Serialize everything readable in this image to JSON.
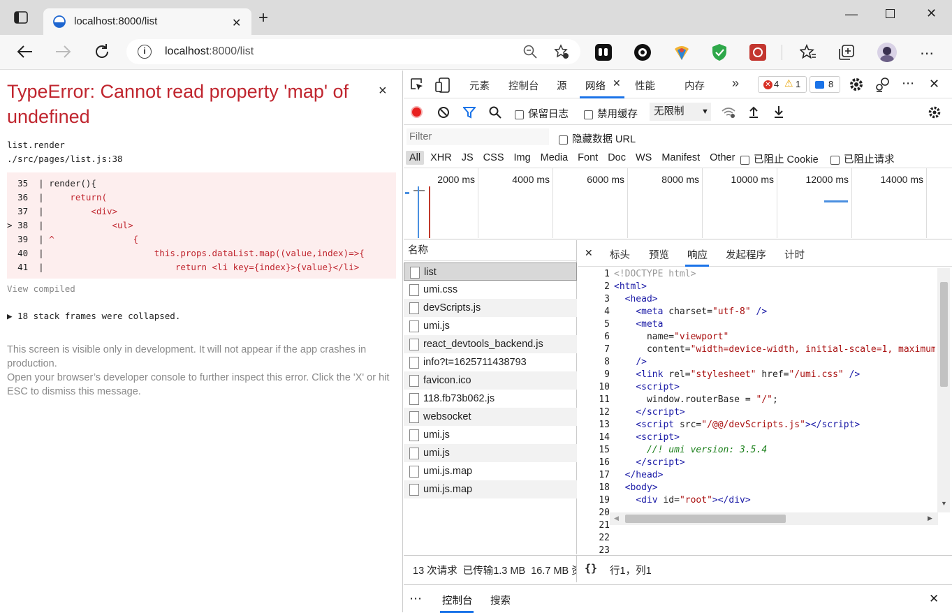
{
  "browser": {
    "tab_title": "localhost:8000/list",
    "url_host": "localhost",
    "url_rest": ":8000/list"
  },
  "error": {
    "title": "TypeError: Cannot read property 'map' of undefined",
    "close": "×",
    "stack_fn": "list.render",
    "stack_file": "./src/pages/list.js:38",
    "code_lines": [
      {
        "marker": " ",
        "num": "35",
        "code": " render(){"
      },
      {
        "marker": " ",
        "num": "36",
        "code": "     return("
      },
      {
        "marker": " ",
        "num": "37",
        "code": "         <div>"
      },
      {
        "marker": ">",
        "num": "38",
        "code": "             <ul>"
      },
      {
        "marker": " ",
        "num": "39",
        "code": " ^               {"
      },
      {
        "marker": " ",
        "num": "40",
        "code": "                     this.props.dataList.map((value,index)=>{"
      },
      {
        "marker": " ",
        "num": "41",
        "code": "                         return <li key={index}>{value}</li>"
      }
    ],
    "view_compiled": "View compiled",
    "collapsed": "▶ 18 stack frames were collapsed.",
    "note1": "This screen is visible only in development. It will not appear if the app crashes in production.",
    "note2": "Open your browser’s developer console to further inspect this error.  Click the 'X' or hit ESC to dismiss this message."
  },
  "devtools": {
    "tabs": [
      "元素",
      "控制台",
      "源",
      "网络",
      "性能",
      "内存"
    ],
    "active_tab": "网络",
    "more": "»",
    "errors_count": "4",
    "warnings_count": "1",
    "messages_count": "8",
    "preserve_log": "保留日志",
    "disable_cache": "禁用缓存",
    "throttle": "无限制",
    "filter_placeholder": "Filter",
    "hide_data_url": "隐藏数据 URL",
    "types": [
      "All",
      "XHR",
      "JS",
      "CSS",
      "Img",
      "Media",
      "Font",
      "Doc",
      "WS",
      "Manifest",
      "Other"
    ],
    "blocked_cookies": "已阻止 Cookie",
    "blocked_requests": "已阻止请求",
    "timeline_labels": [
      "2000 ms",
      "4000 ms",
      "6000 ms",
      "8000 ms",
      "10000 ms",
      "12000 ms",
      "14000 ms"
    ],
    "name_header": "名称",
    "requests": [
      "list",
      "umi.css",
      "devScripts.js",
      "umi.js",
      "react_devtools_backend.js",
      "info?t=1625711438793",
      "favicon.ico",
      "118.fb73b062.js",
      "websocket",
      "umi.js",
      "umi.js",
      "umi.js.map",
      "umi.js.map"
    ],
    "detail_tabs": [
      "标头",
      "预览",
      "响应",
      "发起程序",
      "计时"
    ],
    "active_detail": "响应",
    "line_numbers": [
      "1",
      "2",
      "3",
      "4",
      "5",
      "6",
      "7",
      "8",
      "9",
      "10",
      "11",
      "12",
      "13",
      "14",
      "15",
      "16",
      "17",
      "18",
      "19",
      "20",
      "21",
      "22",
      "23"
    ],
    "status_text": "13 次请求  已传输1.3 MB  16.7 MB 资",
    "cursor_pos": "行1，列1",
    "pretty": "{}",
    "drawer_more": "⋯",
    "drawer_tabs": [
      "控制台",
      "搜索"
    ]
  }
}
